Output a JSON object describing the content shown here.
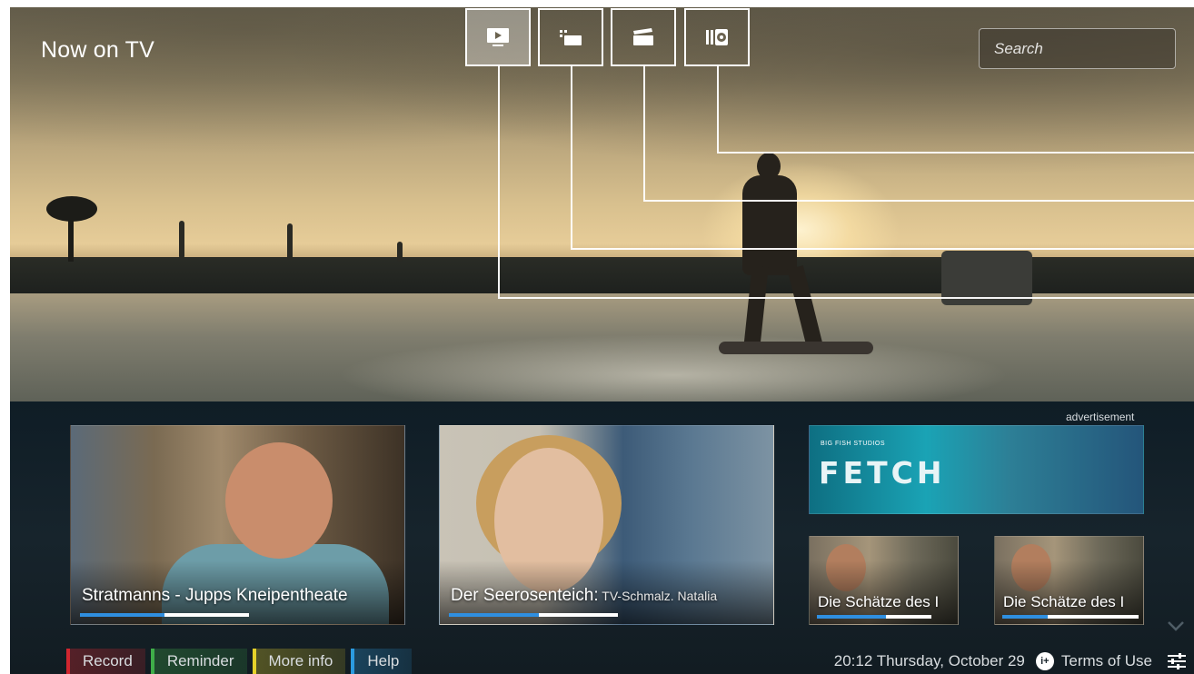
{
  "header": {
    "title": "Now on TV",
    "search_placeholder": "Search"
  },
  "view_modes": [
    {
      "name": "tv-icon",
      "active": true
    },
    {
      "name": "channels-list-icon",
      "active": false
    },
    {
      "name": "movies-clapper-icon",
      "active": false
    },
    {
      "name": "library-icon",
      "active": false
    }
  ],
  "panel": {
    "ad_label": "advertisement",
    "tiles": [
      {
        "title": "Stratmanns - Jupps Kneipentheate",
        "subtitle": "",
        "progress": 0.5
      },
      {
        "title": "Der Seerosenteich:",
        "subtitle": " TV-Schmalz. Natalia",
        "progress": 0.53
      },
      {
        "title": "Die Schätze des I",
        "subtitle": "",
        "progress": 0.6
      },
      {
        "title": "Die Schätze des I",
        "subtitle": "",
        "progress": 0.33
      }
    ],
    "ad": {
      "studio": "BIG FISH STUDIOS",
      "logo": "FETCH"
    }
  },
  "actions": {
    "record": "Record",
    "reminder": "Reminder",
    "more_info": "More info",
    "help": "Help"
  },
  "status": {
    "clock": "20:12 Thursday, October 29",
    "terms": "Terms of Use",
    "terms_icon_glyph": "i+"
  },
  "colors": {
    "red": "#d0262f",
    "green": "#3fae49",
    "yellow": "#e5d12a",
    "blue": "#2b9be0",
    "progress": "#2f8fe0"
  }
}
